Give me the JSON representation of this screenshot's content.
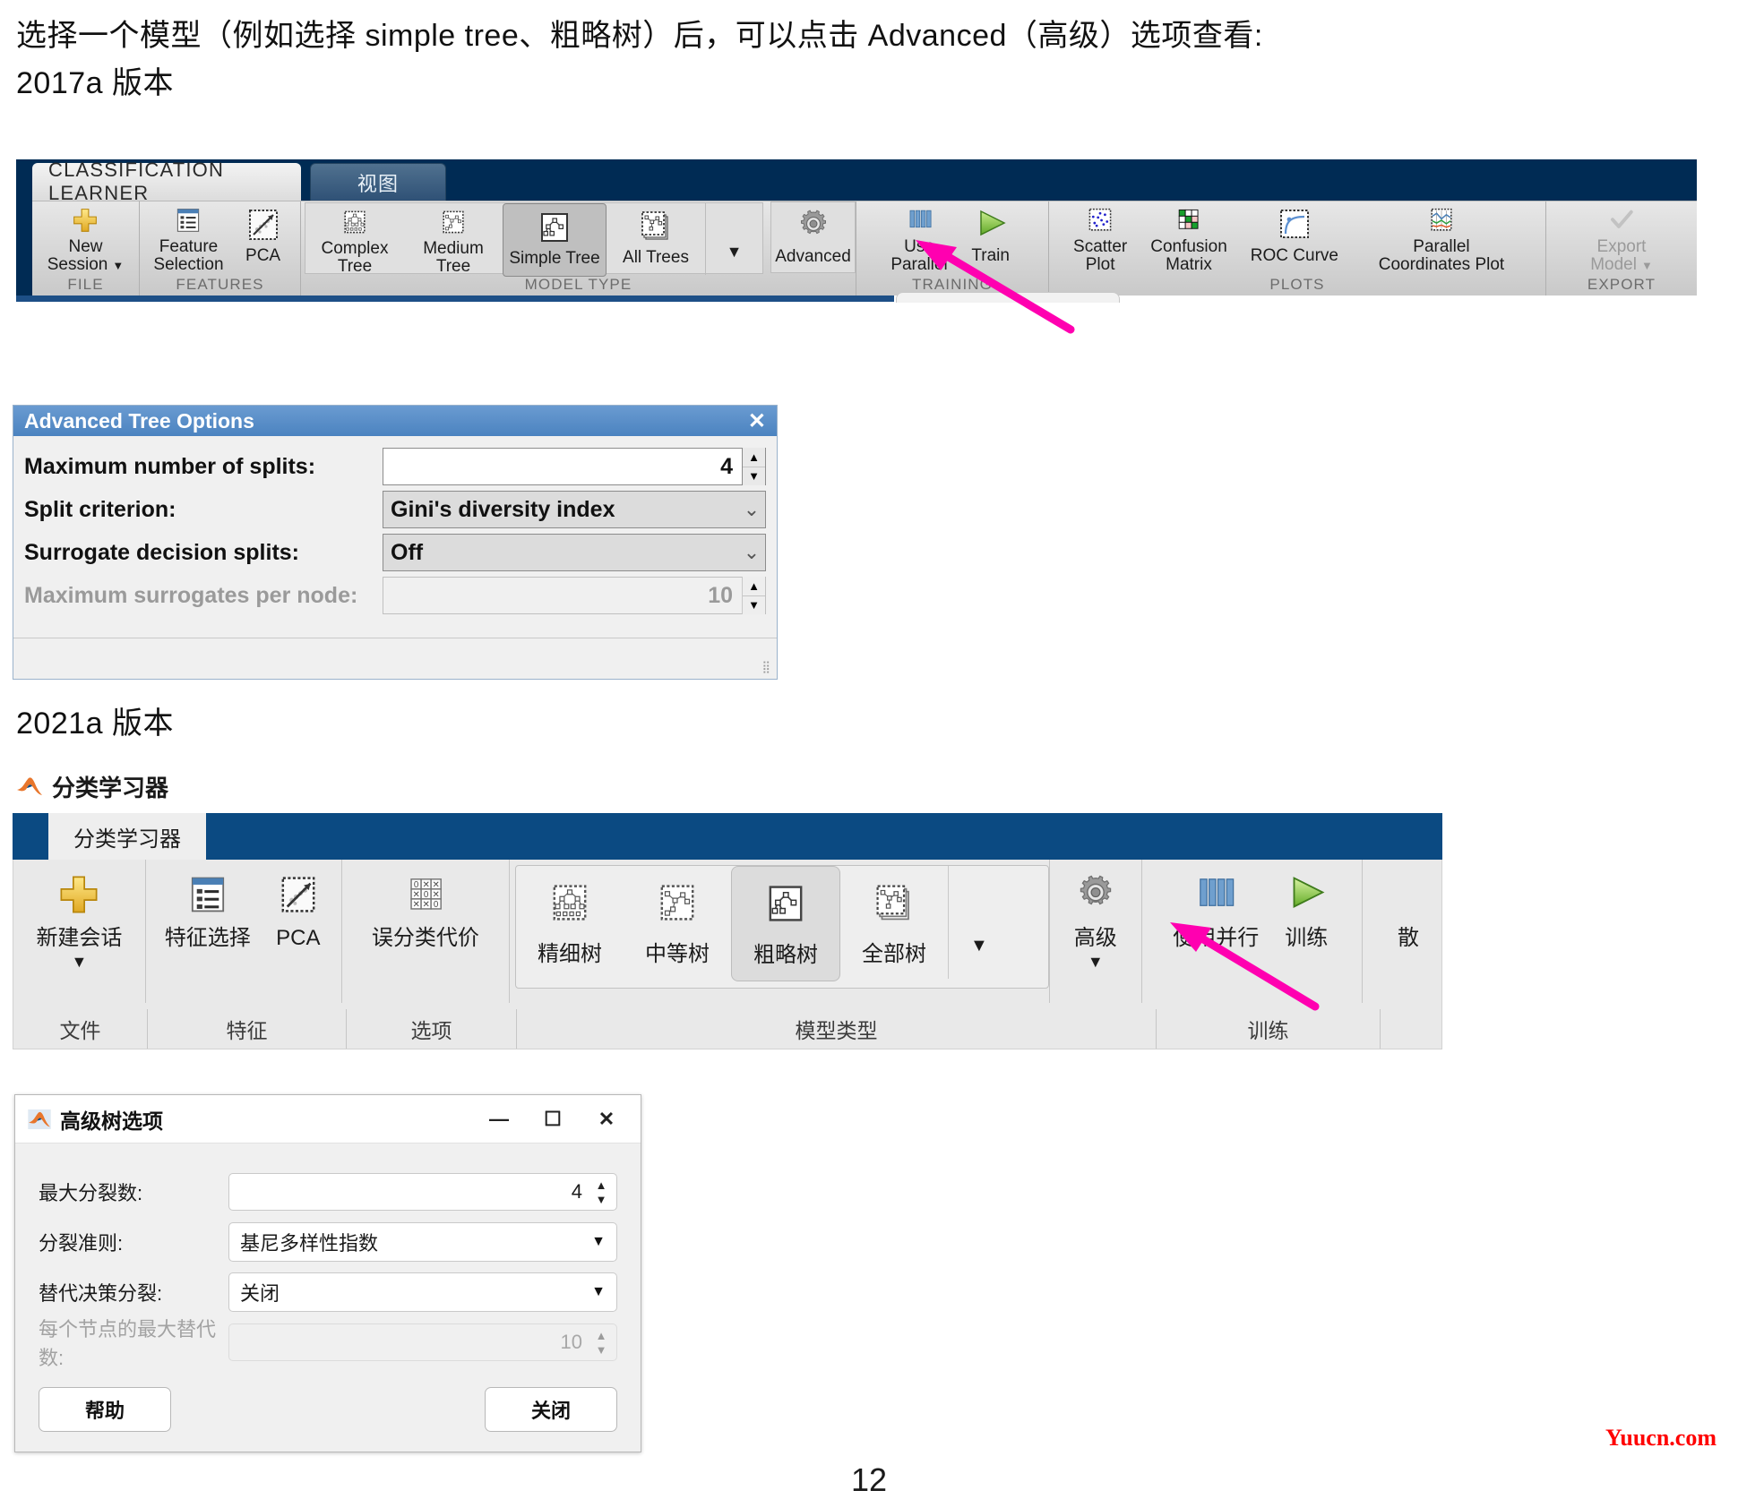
{
  "intro": {
    "line1": "选择一个模型（例如选择 simple tree、粗略树）后，可以点击 Advanced（高级）选项查看:",
    "line2": "2017a 版本"
  },
  "section_2021_label": "2021a 版本",
  "ribbon_2017": {
    "tabs": [
      {
        "label": "CLASSIFICATION LEARNER",
        "active": true
      },
      {
        "label": "视图",
        "active": false
      }
    ],
    "groups": [
      {
        "name": "FILE",
        "buttons": [
          {
            "label_line1": "New",
            "label_line2": "Session",
            "caret": "▼",
            "icon": "plus-icon",
            "state": "normal"
          }
        ]
      },
      {
        "name": "FEATURES",
        "buttons": [
          {
            "label_line1": "Feature",
            "label_line2": "Selection",
            "icon": "feature-selection-icon",
            "state": "normal"
          },
          {
            "label_line1": "PCA",
            "label_line2": "",
            "icon": "pca-icon",
            "state": "normal"
          }
        ]
      },
      {
        "name": "MODEL TYPE",
        "buttons": [
          {
            "label_line1": "Complex",
            "label_line2": "Tree",
            "icon": "complex-tree-icon",
            "state": "normal"
          },
          {
            "label_line1": "Medium",
            "label_line2": "Tree",
            "icon": "medium-tree-icon",
            "state": "normal"
          },
          {
            "label_line1": "Simple Tree",
            "label_line2": "",
            "icon": "simple-tree-icon",
            "state": "selected"
          },
          {
            "label_line1": "All Trees",
            "label_line2": "",
            "icon": "all-trees-icon",
            "state": "normal"
          },
          {
            "label_line1": "▼",
            "label_line2": "",
            "icon": "gallery-expand-icon",
            "state": "caret"
          },
          {
            "label_line1": "Advanced",
            "label_line2": "",
            "icon": "gear-icon",
            "state": "framed"
          }
        ]
      },
      {
        "name": "TRAINING",
        "buttons": [
          {
            "label_line1": "Use",
            "label_line2": "Parallel",
            "icon": "use-parallel-icon",
            "state": "normal"
          },
          {
            "label_line1": "Train",
            "label_line2": "",
            "icon": "train-play-icon",
            "state": "normal"
          }
        ]
      },
      {
        "name": "PLOTS",
        "buttons": [
          {
            "label_line1": "Scatter",
            "label_line2": "Plot",
            "icon": "scatter-plot-icon",
            "state": "normal"
          },
          {
            "label_line1": "Confusion",
            "label_line2": "Matrix",
            "icon": "confusion-matrix-icon",
            "state": "normal"
          },
          {
            "label_line1": "ROC Curve",
            "label_line2": "",
            "icon": "roc-curve-icon",
            "state": "normal"
          },
          {
            "label_line1": "Parallel",
            "label_line2": "Coordinates Plot",
            "icon": "parallel-coordinates-icon",
            "state": "normal"
          }
        ]
      },
      {
        "name": "EXPORT",
        "buttons": [
          {
            "label_line1": "Export",
            "label_line2": "Model",
            "caret": "▼",
            "icon": "export-check-icon",
            "state": "disabled"
          }
        ]
      }
    ]
  },
  "dialog_2017": {
    "title": "Advanced Tree Options",
    "close_icon": "✕",
    "rows": [
      {
        "label": "Maximum number of splits:",
        "value": "4",
        "control": "spinner",
        "disabled": false
      },
      {
        "label": "Split criterion:",
        "value": "Gini's diversity index",
        "control": "combo",
        "disabled": false
      },
      {
        "label": "Surrogate decision splits:",
        "value": "Off",
        "control": "combo",
        "disabled": false
      },
      {
        "label": "Maximum surrogates per node:",
        "value": "10",
        "control": "spinner",
        "disabled": true
      }
    ]
  },
  "app_2021": {
    "window_title": "分类学习器",
    "logo_icon": "matlab-logo-icon",
    "ribbon": {
      "tabs": [
        {
          "label": "分类学习器",
          "active": true
        }
      ],
      "groups": [
        {
          "name": "文件",
          "buttons": [
            {
              "label": "新建会话",
              "caret": "▼",
              "icon": "plus-icon"
            }
          ]
        },
        {
          "name": "特征",
          "buttons": [
            {
              "label": "特征选择",
              "icon": "feature-selection-icon"
            },
            {
              "label": "PCA",
              "icon": "pca-icon"
            }
          ]
        },
        {
          "name": "选项",
          "buttons": [
            {
              "label": "误分类代价",
              "icon": "misclassification-cost-icon"
            }
          ]
        },
        {
          "name": "模型类型",
          "buttons": [
            {
              "label": "精细树",
              "icon": "fine-tree-icon",
              "state": "normal"
            },
            {
              "label": "中等树",
              "icon": "medium-tree-icon",
              "state": "normal"
            },
            {
              "label": "粗略树",
              "icon": "coarse-tree-icon",
              "state": "selected"
            },
            {
              "label": "全部树",
              "icon": "all-trees-icon",
              "state": "normal"
            },
            {
              "label": "▼",
              "icon": "gallery-expand-icon",
              "state": "caret"
            },
            {
              "label": "高级",
              "caret": "▼",
              "icon": "gear-icon",
              "state": "normal"
            }
          ]
        },
        {
          "name": "训练",
          "buttons": [
            {
              "label": "使用并行",
              "icon": "use-parallel-icon"
            },
            {
              "label": "训练",
              "icon": "train-play-icon"
            }
          ]
        },
        {
          "name": "",
          "buttons": [
            {
              "label": "散",
              "icon": "scatter-plot-icon"
            }
          ]
        }
      ]
    }
  },
  "dialog_2021": {
    "title": "高级树选项",
    "logo_icon": "matlab-logo-icon",
    "window_buttons": [
      {
        "name": "minimize",
        "glyph": "—"
      },
      {
        "name": "maximize",
        "glyph": "☐"
      },
      {
        "name": "close",
        "glyph": "✕"
      }
    ],
    "rows": [
      {
        "label": "最大分裂数:",
        "value": "4",
        "control": "spinner",
        "disabled": false
      },
      {
        "label": "分裂准则:",
        "value": "基尼多样性指数",
        "control": "combo",
        "disabled": false
      },
      {
        "label": "替代决策分裂:",
        "value": "关闭",
        "control": "combo",
        "disabled": false
      },
      {
        "label": "每个节点的最大替代数:",
        "value": "10",
        "control": "spinner",
        "disabled": true
      }
    ],
    "help_button": "帮助",
    "close_button": "关闭"
  },
  "page_number": "12",
  "watermark": "Yuucn.com",
  "colors": {
    "ribbon_2017_header": "#002b54",
    "ribbon_2021_header": "#0b4a82",
    "dialog_2017_titlebar": "#4b83c0",
    "arrow": "#ff00b0",
    "watermark": "#ff0000",
    "accent_green": "#7cc13a",
    "accent_blue": "#4a7fb5",
    "accent_yellow": "#f2c230"
  }
}
